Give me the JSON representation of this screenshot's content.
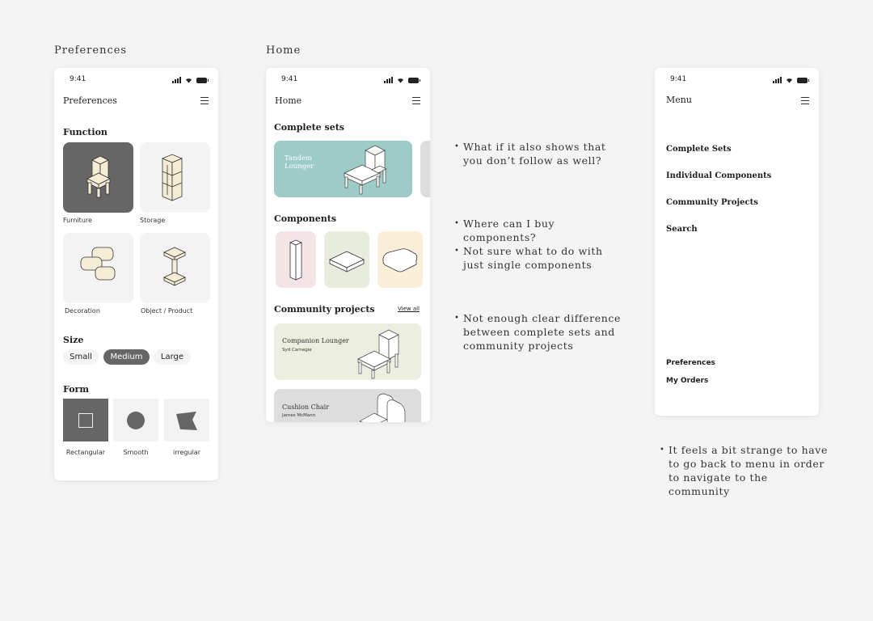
{
  "frames": {
    "preferences_label": "Preferences",
    "home_label": "Home"
  },
  "status": {
    "time": "9:41"
  },
  "preferences": {
    "nav_title": "Preferences",
    "function_heading": "Function",
    "function_items": [
      {
        "label": "Furniture"
      },
      {
        "label": "Storage"
      },
      {
        "label": "Decoration"
      },
      {
        "label": "Object / Product"
      }
    ],
    "size_heading": "Size",
    "size_options": [
      "Small",
      "Medium",
      "Large"
    ],
    "size_selected": "Medium",
    "form_heading": "Form",
    "form_options": [
      "Rectangular",
      "Smooth",
      "irregular"
    ],
    "form_selected": "Rectangular"
  },
  "home": {
    "nav_title": "Home",
    "complete_sets_heading": "Complete sets",
    "set_card_line1": "Tandem",
    "set_card_line2": "Lounger",
    "components_heading": "Components",
    "community_heading": "Community projects",
    "view_all": "View all",
    "projects": [
      {
        "title": "Companion Lounger",
        "author": "Syd Carnegie"
      },
      {
        "title": "Cushion Chair",
        "author": "James McMann"
      }
    ]
  },
  "menu": {
    "nav_title": "Menu",
    "items": [
      "Complete Sets",
      "Individual Components",
      "Community Projects",
      "Search"
    ],
    "bottom_items": [
      "Preferences",
      "My Orders"
    ]
  },
  "notes": {
    "group1": [
      {
        "line1": "What if it also shows that",
        "line2": "you don’t follow as well?"
      }
    ],
    "group2": [
      {
        "line1": "Where can I buy",
        "line2": "components?"
      },
      {
        "line1": "Not sure what to do with",
        "line2": "just single components"
      }
    ],
    "group3": [
      {
        "line1": "Not enough clear difference",
        "line2": "between complete sets and",
        "line3": "community projects"
      }
    ],
    "group4": [
      {
        "line1": "It feels a bit strange to have",
        "line2": "to go back to menu in order",
        "line3": "to navigate to the",
        "line4": "community"
      }
    ]
  },
  "colors": {
    "set_card": "#9ccbc8",
    "component_pink": "#f3e5e6",
    "component_green": "#e8ecdc",
    "component_cream": "#fcefd9",
    "project_green": "#eceee0",
    "project_grey": "#dddddd",
    "selected": "#666666"
  }
}
